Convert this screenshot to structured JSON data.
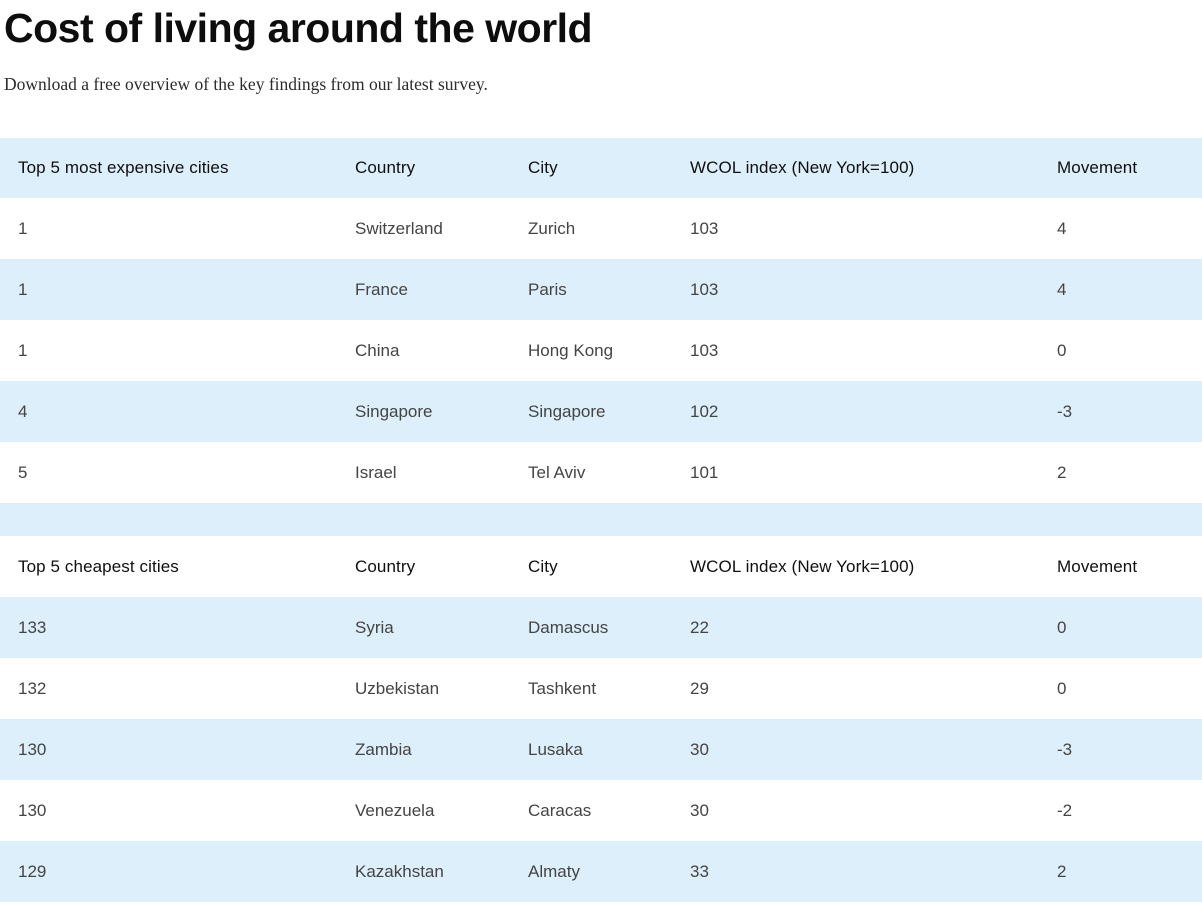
{
  "page": {
    "title": "Cost of living around the world",
    "subtitle": "Download a free overview of the key findings from our latest survey."
  },
  "colors": {
    "stripe_blue": "#ddeffa",
    "header_text": "#0f0f0f",
    "body_text": "#444444",
    "title_text": "#0d0d0d"
  },
  "tables": [
    {
      "label": "Top 5 most expensive cities",
      "columns": [
        "Country",
        "City",
        "WCOL index (New York=100)",
        "Movement"
      ],
      "rows": [
        {
          "rank": "1",
          "country": "Switzerland",
          "city": "Zurich",
          "index": "103",
          "movement": "4"
        },
        {
          "rank": "1",
          "country": "France",
          "city": "Paris",
          "index": "103",
          "movement": "4"
        },
        {
          "rank": "1",
          "country": "China",
          "city": "Hong Kong",
          "index": "103",
          "movement": "0"
        },
        {
          "rank": "4",
          "country": "Singapore",
          "city": "Singapore",
          "index": "102",
          "movement": "-3"
        },
        {
          "rank": "5",
          "country": "Israel",
          "city": "Tel Aviv",
          "index": "101",
          "movement": "2"
        }
      ]
    },
    {
      "label": "Top 5 cheapest cities",
      "columns": [
        "Country",
        "City",
        "WCOL index (New York=100)",
        "Movement"
      ],
      "rows": [
        {
          "rank": "133",
          "country": "Syria",
          "city": "Damascus",
          "index": "22",
          "movement": "0"
        },
        {
          "rank": "132",
          "country": "Uzbekistan",
          "city": "Tashkent",
          "index": "29",
          "movement": "0"
        },
        {
          "rank": "130",
          "country": "Zambia",
          "city": "Lusaka",
          "index": "30",
          "movement": "-3"
        },
        {
          "rank": "130",
          "country": "Venezuela",
          "city": "Caracas",
          "index": "30",
          "movement": "-2"
        },
        {
          "rank": "129",
          "country": "Kazakhstan",
          "city": "Almaty",
          "index": "33",
          "movement": "2"
        }
      ]
    }
  ]
}
